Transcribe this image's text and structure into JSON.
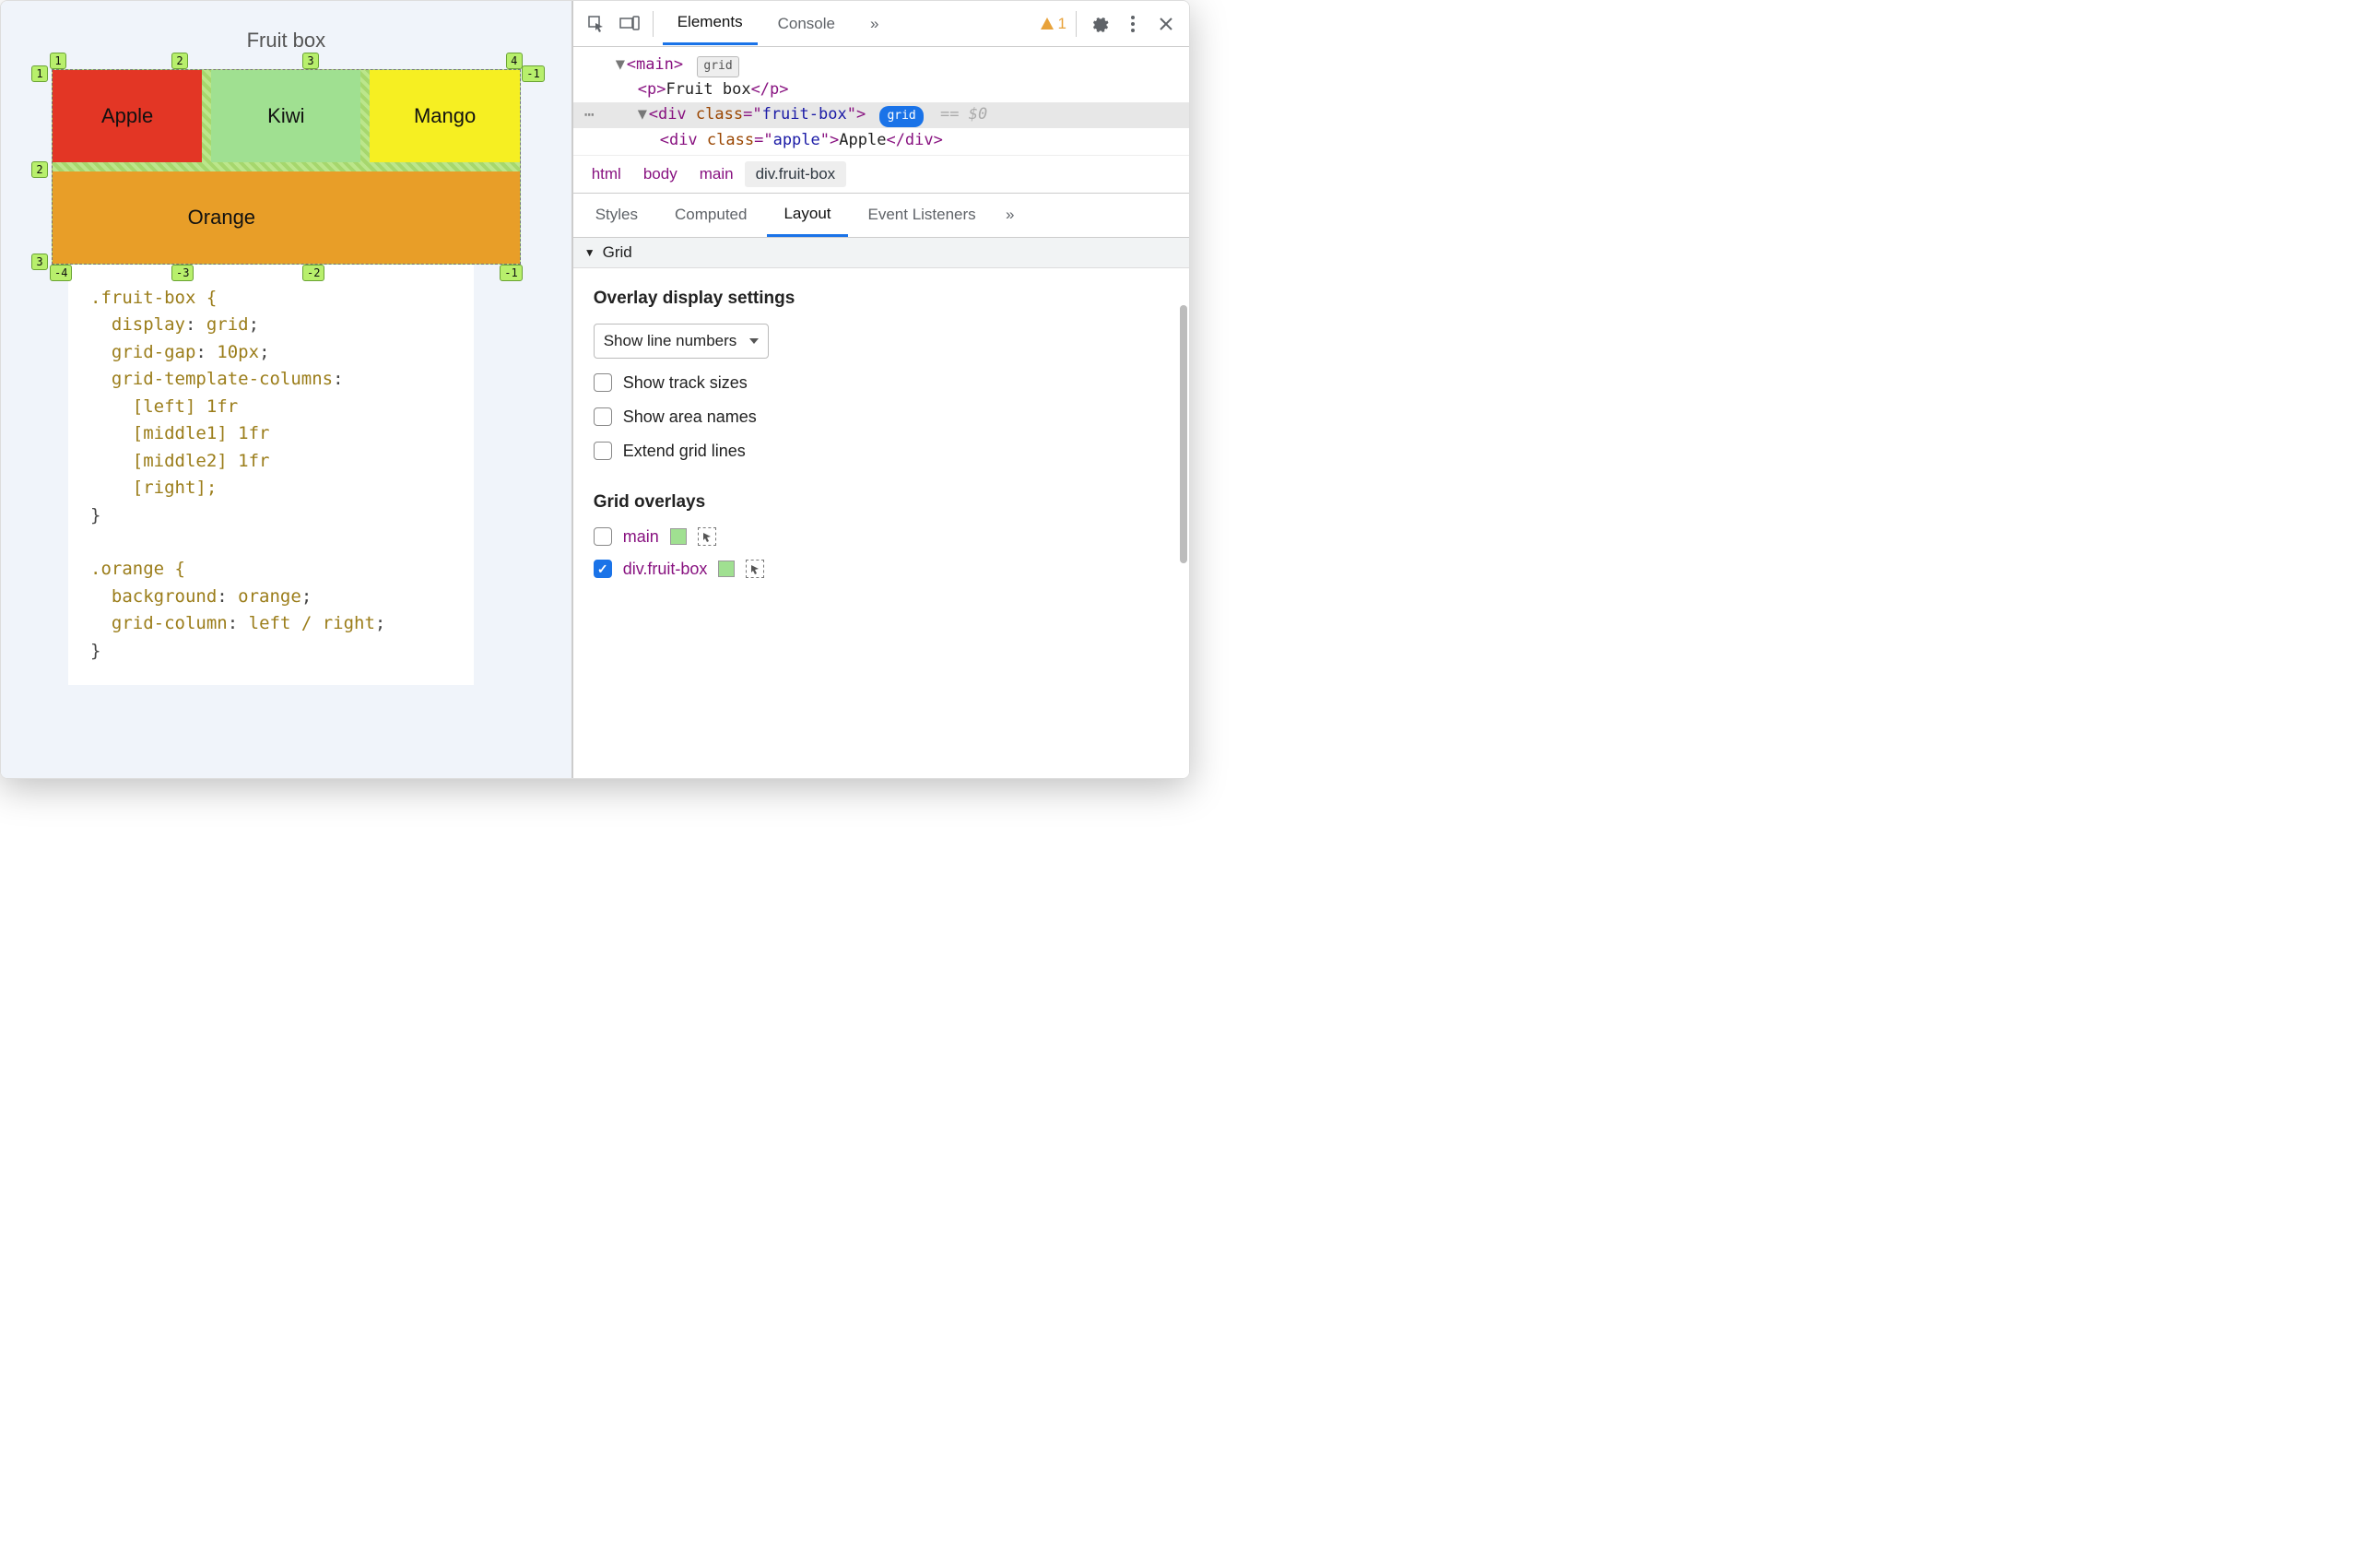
{
  "page": {
    "title": "Fruit box",
    "cells": {
      "apple": "Apple",
      "kiwi": "Kiwi",
      "mango": "Mango",
      "orange": "Orange"
    },
    "line_tags_top": [
      "1",
      "2",
      "3",
      "4"
    ],
    "line_tags_left": [
      "1",
      "2",
      "3"
    ],
    "line_tags_right": [
      "-1"
    ],
    "line_tags_bottom": [
      "-4",
      "-3",
      "-2",
      "-1"
    ]
  },
  "css": {
    "rule1_selector": ".fruit-box {",
    "rule1": [
      {
        "prop": "display",
        "val": "grid"
      },
      {
        "prop": "grid-gap",
        "val": "10px"
      },
      {
        "prop": "grid-template-columns",
        "val": ""
      }
    ],
    "rule1_cols": [
      "[left] 1fr",
      "[middle1] 1fr",
      "[middle2] 1fr",
      "[right];"
    ],
    "rule1_close": "}",
    "rule2_selector": ".orange {",
    "rule2": [
      {
        "prop": "background",
        "val": "orange"
      },
      {
        "prop": "grid-column",
        "val": "left / right"
      }
    ],
    "rule2_close": "}"
  },
  "devtools": {
    "tabs": {
      "elements": "Elements",
      "console": "Console",
      "more": "»"
    },
    "warning_count": "1",
    "dom": {
      "main_open": "<main>",
      "main_badge": "grid",
      "p_line": {
        "open": "<p>",
        "text": "Fruit box",
        "close": "</p>"
      },
      "div_line": {
        "open": "<div ",
        "attr": "class",
        "val": "fruit-box",
        "close": ">",
        "badge": "grid",
        "suffix": "== $0"
      },
      "apple_line": {
        "open": "<div ",
        "attr": "class",
        "val": "apple",
        "mid": ">",
        "text": "Apple",
        "close": "</div>"
      }
    },
    "crumbs": [
      "html",
      "body",
      "main",
      "div.fruit-box"
    ],
    "subtabs": [
      "Styles",
      "Computed",
      "Layout",
      "Event Listeners",
      "»"
    ],
    "section_title": "Grid",
    "overlay_settings_title": "Overlay display settings",
    "line_number_select": "Show line numbers",
    "checks": [
      {
        "label": "Show track sizes",
        "checked": false
      },
      {
        "label": "Show area names",
        "checked": false
      },
      {
        "label": "Extend grid lines",
        "checked": false
      }
    ],
    "grid_overlays_title": "Grid overlays",
    "overlays": [
      {
        "label": "main",
        "checked": false,
        "swatch": "green"
      },
      {
        "label": "div.fruit-box",
        "checked": true,
        "swatch": "green"
      }
    ]
  }
}
